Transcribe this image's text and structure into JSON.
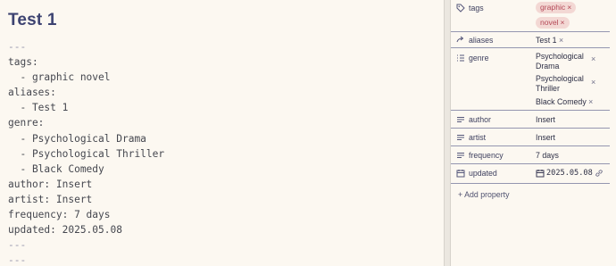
{
  "note": {
    "title": "Test 1",
    "source_lines": [
      "---",
      "tags:",
      "  - graphic novel",
      "aliases:",
      "  - Test 1",
      "genre:",
      "  - Psychological Drama",
      "  - Psychological Thriller",
      "  - Black Comedy",
      "author: Insert",
      "artist: Insert",
      "frequency: 7 days",
      "updated: 2025.05.08",
      "---",
      "---"
    ]
  },
  "properties": {
    "tags": {
      "name": "tags",
      "icon": "tag-icon",
      "values": [
        "graphic",
        "novel"
      ]
    },
    "aliases": {
      "name": "aliases",
      "icon": "forward-arrow-icon",
      "value": "Test 1"
    },
    "genre": {
      "name": "genre",
      "icon": "list-icon",
      "items": [
        [
          "Psychological",
          "Drama"
        ],
        [
          "Psychological",
          "Thriller"
        ],
        [
          "Black Comedy"
        ]
      ]
    },
    "author": {
      "name": "author",
      "icon": "text-icon",
      "value": "Insert"
    },
    "artist": {
      "name": "artist",
      "icon": "text-icon",
      "value": "Insert"
    },
    "frequency": {
      "name": "frequency",
      "icon": "text-icon",
      "value": "7 days"
    },
    "updated": {
      "name": "updated",
      "icon": "calendar-icon",
      "value": "2025.05.08"
    },
    "add_label": "+ Add property",
    "remove_glyph": "×"
  },
  "colors": {
    "background": "#fcf8f1",
    "title": "#3d4371",
    "tag_pill_bg": "#f3d8d4",
    "tag_pill_text": "#b54a58",
    "divider": "#9496b0"
  }
}
